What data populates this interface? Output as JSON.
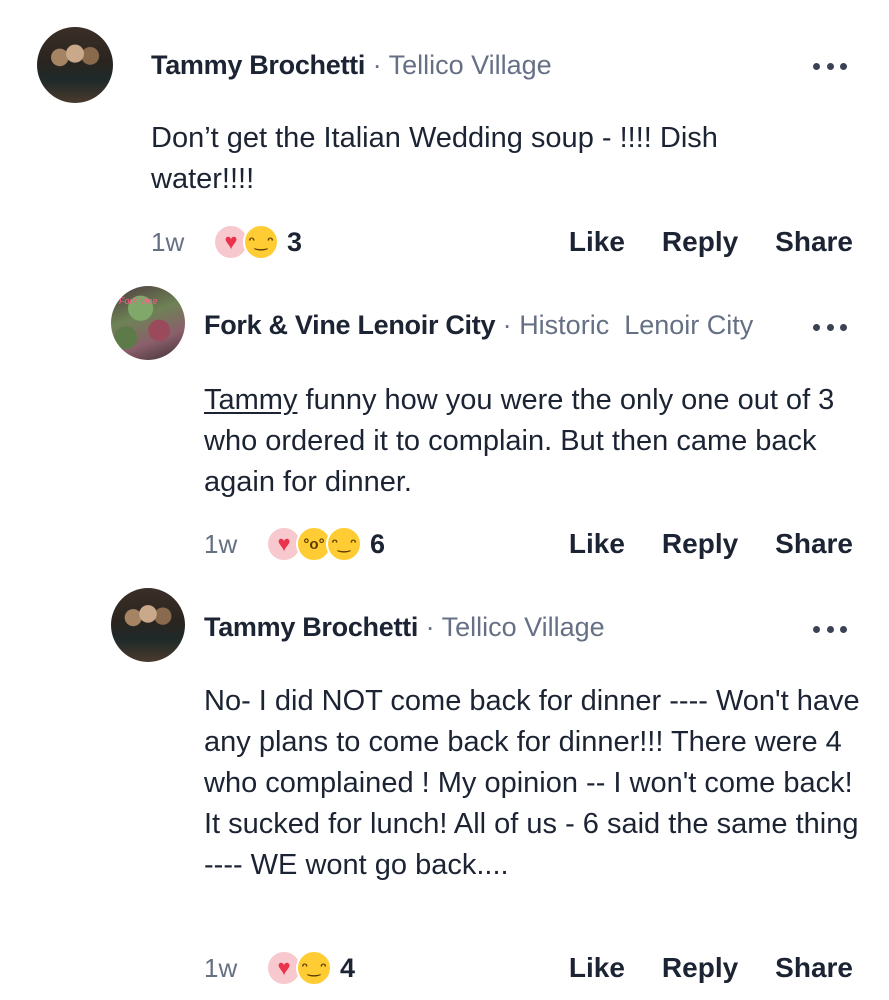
{
  "comments": [
    {
      "author": "Tammy Brochetti",
      "separator": "·",
      "location": "Tellico Village",
      "text": "Don’t get the Italian Wedding soup - !!!!    Dish water!!!!",
      "time": "1w",
      "reactions": [
        "heart",
        "haha"
      ],
      "reaction_count": "3",
      "actions": {
        "like": "Like",
        "reply": "Reply",
        "share": "Share"
      }
    },
    {
      "author": "Fork & Vine Lenoir City",
      "separator": "·",
      "location": "Historic  Lenoir City",
      "avatar_text": "Fork Vine",
      "mention": "Tammy",
      "text": " funny how you were the only one out of 3 who ordered it to complain. But then came back again for dinner.",
      "time": "1w",
      "reactions": [
        "heart",
        "wow",
        "haha"
      ],
      "reaction_count": "6",
      "actions": {
        "like": "Like",
        "reply": "Reply",
        "share": "Share"
      }
    },
    {
      "author": "Tammy Brochetti",
      "separator": "·",
      "location": "Tellico Village",
      "text": "No- I did NOT come back for dinner ---- Won't have any plans to come back for dinner!!! There were 4 who complained !   My opinion -- I won't come back!   It sucked for lunch!   All of us - 6 said the same thing ---- WE wont go back....",
      "time": "1w",
      "reactions": [
        "heart",
        "haha"
      ],
      "reaction_count": "4",
      "actions": {
        "like": "Like",
        "reply": "Reply",
        "share": "Share"
      }
    }
  ],
  "icons": {
    "more": "more-options-icon",
    "heart": "heart-reaction-icon",
    "haha": "haha-reaction-icon",
    "wow": "wow-reaction-icon"
  },
  "colors": {
    "text": "#1c2434",
    "secondary": "#667085",
    "heart": "#e8334a",
    "emoji": "#ffcc33"
  }
}
